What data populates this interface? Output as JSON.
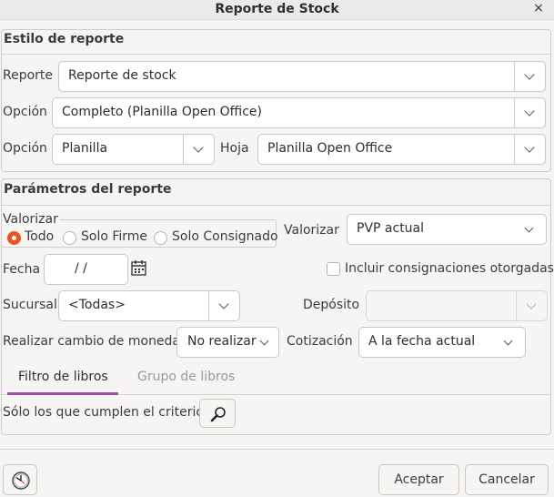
{
  "window": {
    "title": "Reporte de Stock",
    "close_glyph": "×"
  },
  "estilo": {
    "title": "Estilo de reporte",
    "reporte_label": "Reporte",
    "reporte_value": "Reporte de stock",
    "opcion1_label": "Opción",
    "opcion1_value": "Completo (Planilla Open Office)",
    "opcion2_label": "Opción",
    "opcion2_value": "Planilla",
    "hoja_label": "Hoja",
    "hoja_value": "Planilla Open Office"
  },
  "parametros": {
    "title": "Parámetros del reporte",
    "valorizar_group_label": "Valorizar",
    "radios": [
      {
        "label": "Todo",
        "checked": true
      },
      {
        "label": "Solo Firme",
        "checked": false
      },
      {
        "label": "Solo Consignado",
        "checked": false
      }
    ],
    "valorizar_label": "Valorizar",
    "valorizar_value": "PVP actual",
    "fecha_label": "Fecha",
    "fecha_value": "/ /",
    "incluir_label": "Incluir consignaciones otorgadas",
    "sucursal_label": "Sucursal",
    "sucursal_value": "<Todas>",
    "deposito_label": "Depósito",
    "deposito_value": "",
    "moneda_label": "Realizar cambio de moneda",
    "moneda_value": "No realizar",
    "cotizacion_label": "Cotización",
    "cotizacion_value": "A la fecha actual"
  },
  "tabs": [
    {
      "label": "Filtro de libros",
      "active": true
    },
    {
      "label": "Grupo de libros",
      "active": false
    }
  ],
  "filtro": {
    "criterio_label": "Sólo los que cumplen el criterio"
  },
  "footer": {
    "aceptar_label": "Aceptar",
    "cancelar_label": "Cancelar"
  },
  "colors": {
    "accent": "#e95420",
    "tab_active": "#a64ca6",
    "background": "#f6f5f4"
  },
  "icons": {
    "close": "close-icon",
    "chevron": "chevron-down-icon",
    "calendar": "calendar-icon",
    "search": "magnifier-icon",
    "clock": "clock-icon"
  }
}
